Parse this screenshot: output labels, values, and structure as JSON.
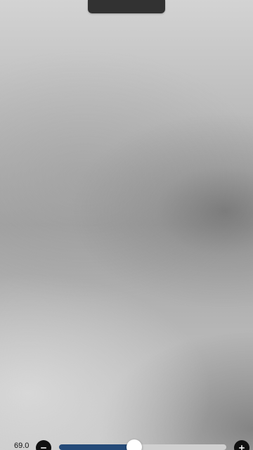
{
  "top_bar": {
    "visible": true
  },
  "control": {
    "value_label": "69.0",
    "slider_fraction": 0.45,
    "minus_icon": "minus-icon",
    "plus_icon": "plus-icon",
    "accent_color": "#244a78"
  }
}
